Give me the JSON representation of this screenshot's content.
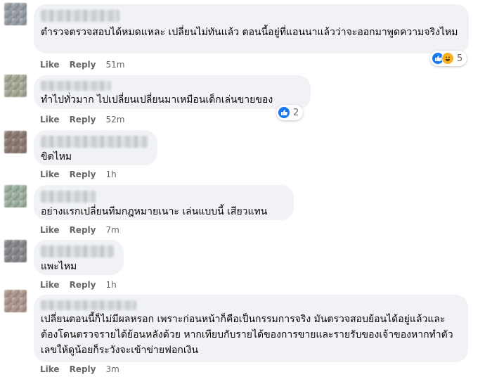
{
  "actions": {
    "like_label": "Like",
    "reply_label": "Reply"
  },
  "comments": [
    {
      "text": "ตำรวจตรวจสอบได้หมดแหละ เปลี่ยนไม่ทันแล้ว ตอนนี้อยู่ที่แอนนาแล้วว่าจะออกมาพูดความจริงไหม",
      "time": "51m",
      "reaction_count": "5",
      "reaction_icons": [
        "like-icon",
        "haha-icon"
      ]
    },
    {
      "text": "ทำไปทั่วมาก ไปเปลี่ยนเปลี่ยนมาเหมือนเด็กเล่นขายของ",
      "time": "52m",
      "reaction_count": "2",
      "reaction_icons": [
        "like-icon"
      ]
    },
    {
      "text": "ขิตไหม",
      "time": "1h"
    },
    {
      "text": "อย่างแรกเปลี่ยนทีมกฎหมายเนาะ เล่นแบบนี้ เสียวแทน",
      "time": "7m"
    },
    {
      "text": "แพะไหม",
      "time": "1h"
    },
    {
      "text": "เปลี่ยนตอนนี้ก็ไม่มีผลหรอก เพราะก่อนหน้าก็คือเป็นกรรมการจริง มันตรวจสอบย้อนได้อยู่แล้วและต้องโดนตรวจรายได้ย้อนหลังด้วย หากเทียบกับรายได้ของการขายและรายรับของเจ้าของหากทำตัวเลขให้ดูน้อยก็ระวังจะเข้าข่ายฟอกเงิน",
      "time": "3m"
    }
  ],
  "colors": {
    "bubble": "#f0f2f5",
    "meta": "#65676b",
    "like": "#1877f2",
    "haha": "#f7b125"
  }
}
